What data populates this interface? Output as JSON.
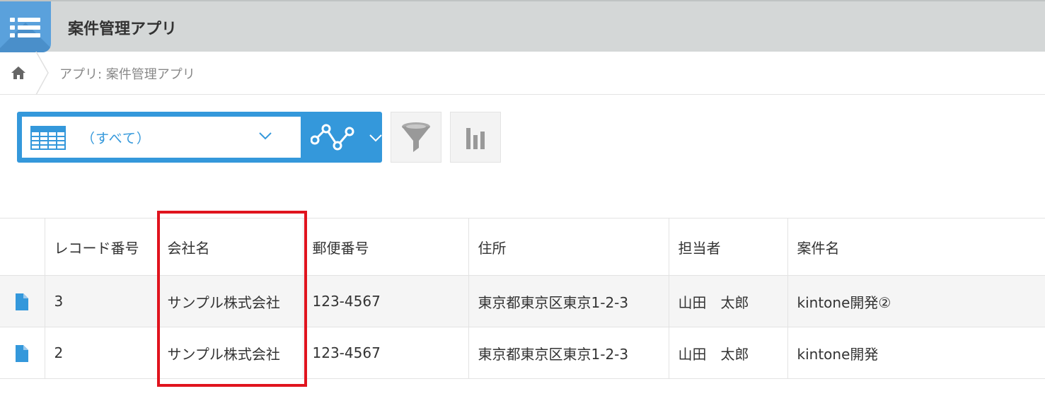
{
  "header": {
    "app_title": "案件管理アプリ",
    "app_icon": "list-app-icon",
    "background_color": "#d4d7d7",
    "icon_color": "#5aa1dc"
  },
  "breadcrumb": {
    "home_icon": "home-icon",
    "text": "アプリ: 案件管理アプリ"
  },
  "toolbar": {
    "view_label": "（すべて）",
    "view_icon": "table-view-icon",
    "graph_icon": "graph-icon",
    "filter_icon": "filter-icon",
    "chart_icon": "bar-chart-icon",
    "accent_color": "#3498db"
  },
  "table": {
    "columns": [
      "",
      "レコード番号",
      "会社名",
      "郵便番号",
      "住所",
      "担当者",
      "案件名"
    ],
    "rows": [
      {
        "record_no": "3",
        "company": "サンプル株式会社",
        "zip": "123-4567",
        "address": "東京都東京区東京1-2-3",
        "person": "山田　太郎",
        "project": "kintone開発②"
      },
      {
        "record_no": "2",
        "company": "サンプル株式会社",
        "zip": "123-4567",
        "address": "東京都東京区東京1-2-3",
        "person": "山田　太郎",
        "project": "kintone開発"
      }
    ],
    "row_icon": "document-icon"
  },
  "highlight": {
    "target_column": "会社名",
    "color": "#e0141e"
  }
}
